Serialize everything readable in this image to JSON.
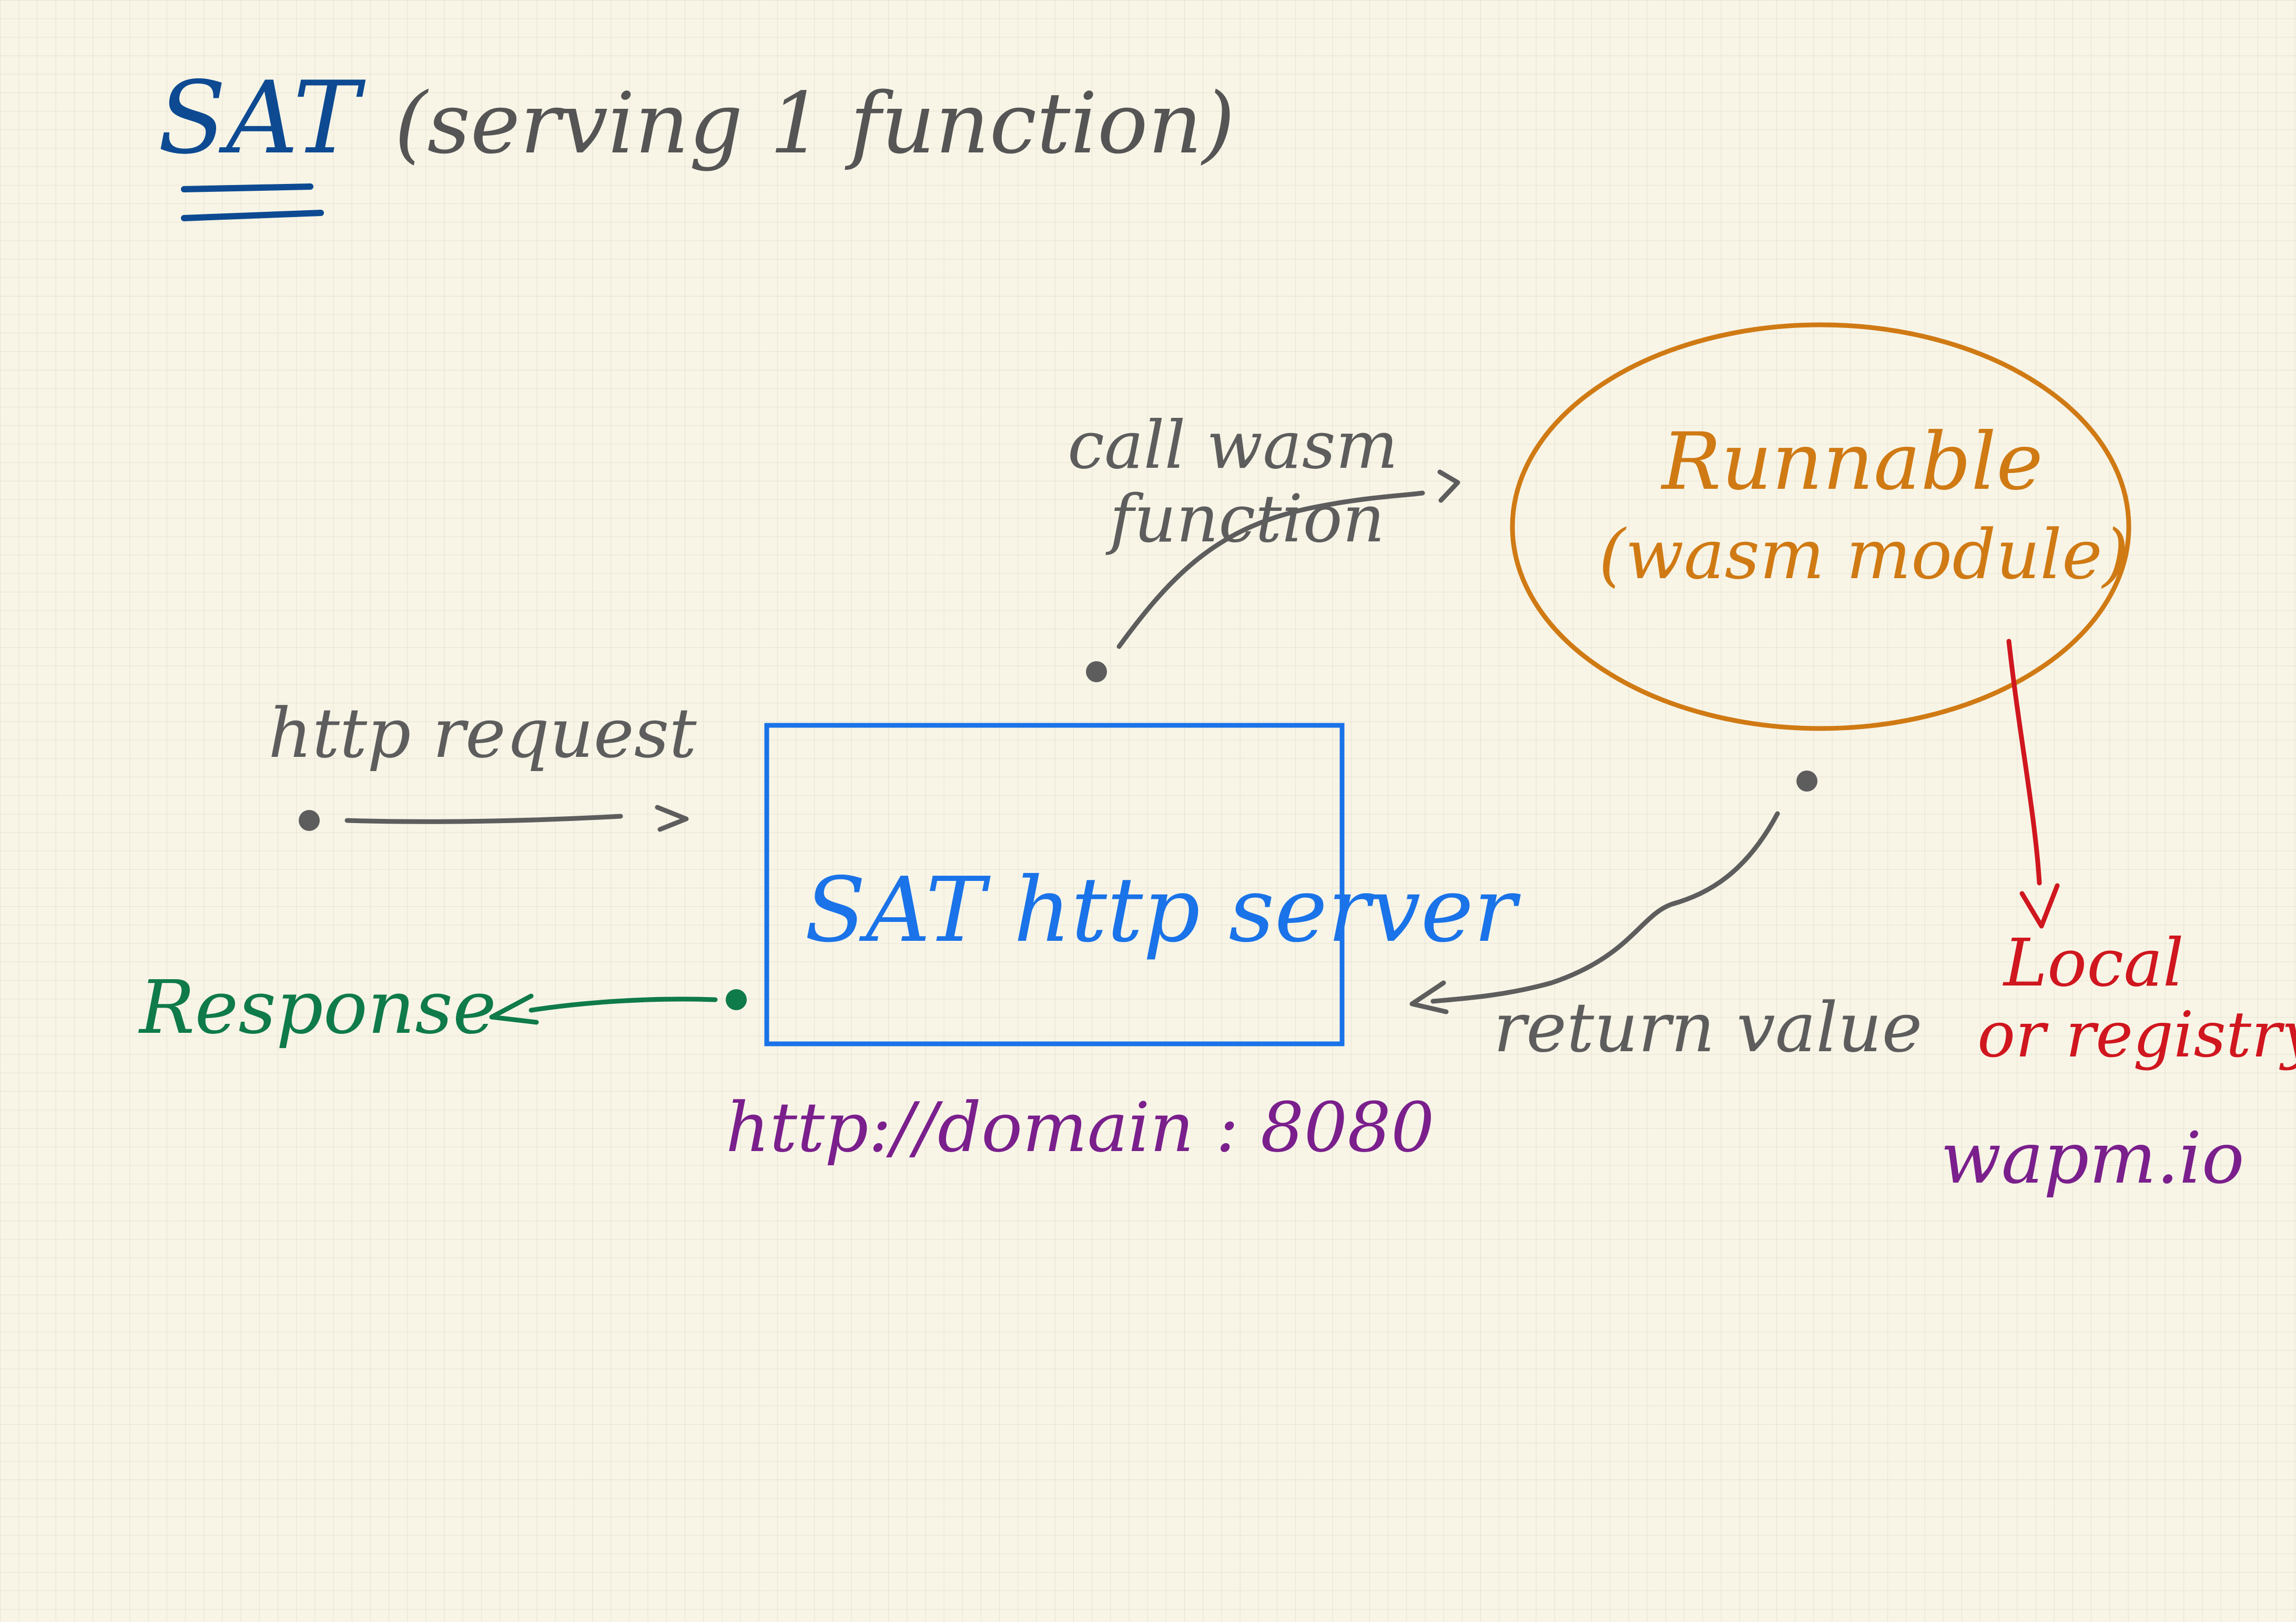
{
  "title": {
    "main": "SAT",
    "subtitle": "(serving 1 function)",
    "color": "#0d4a92"
  },
  "server": {
    "label": "SAT http server",
    "url": "http://domain : 8080",
    "color": "#1a73e8",
    "url_color": "#7a1f8c"
  },
  "runnable": {
    "title": "Runnable",
    "subtitle": "(wasm module)",
    "color": "#d07a14"
  },
  "edges": {
    "http_request": "http request",
    "call_wasm_line1": "call wasm",
    "call_wasm_line2": "function",
    "return_value": "return value",
    "response": "Response",
    "gray": "#5d5d5d",
    "green": "#0f7a4a"
  },
  "source": {
    "line1": "Local",
    "line2": "or registry",
    "registry": "wapm.io",
    "color": "#d0161e",
    "registry_color": "#7a1f8c"
  },
  "icons": [
    "arrow-icon",
    "dot-icon"
  ]
}
